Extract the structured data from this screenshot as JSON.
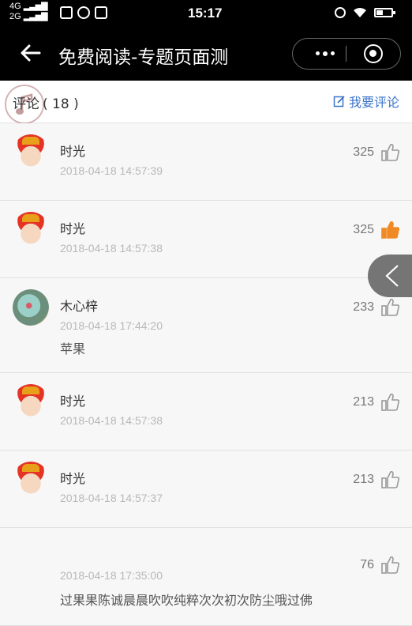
{
  "status_bar": {
    "network_top": "4G",
    "network_bottom": "2G",
    "time": "15:17"
  },
  "nav": {
    "title": "免费阅读-专题页面测"
  },
  "comments_header": {
    "label": "评论",
    "count": "( 18 )",
    "write_label": "我要评论"
  },
  "comments": [
    {
      "name": "时光",
      "time": "2018-04-18 14:57:39",
      "text": "",
      "likes": "325",
      "liked": false,
      "avatar": "cartoon-avatar"
    },
    {
      "name": "时光",
      "time": "2018-04-18 14:57:38",
      "text": "",
      "likes": "325",
      "liked": true,
      "avatar": "cartoon-avatar"
    },
    {
      "name": "木心梓",
      "time": "2018-04-18 17:44:20",
      "text": "苹果",
      "likes": "233",
      "liked": false,
      "avatar": "flower-avatar"
    },
    {
      "name": "时光",
      "time": "2018-04-18 14:57:38",
      "text": "",
      "likes": "213",
      "liked": false,
      "avatar": "cartoon-avatar"
    },
    {
      "name": "时光",
      "time": "2018-04-18 14:57:37",
      "text": "",
      "likes": "213",
      "liked": false,
      "avatar": "cartoon-avatar"
    },
    {
      "name": "",
      "time": "2018-04-18 17:35:00",
      "text": "过果果陈诚晨晨吹吹纯粹次次初次防尘哦过佛",
      "likes": "76",
      "liked": false,
      "avatar": ""
    }
  ],
  "colors": {
    "accent_blue": "#3a73c9",
    "liked_orange": "#f08a24",
    "like_gray": "#999999"
  }
}
